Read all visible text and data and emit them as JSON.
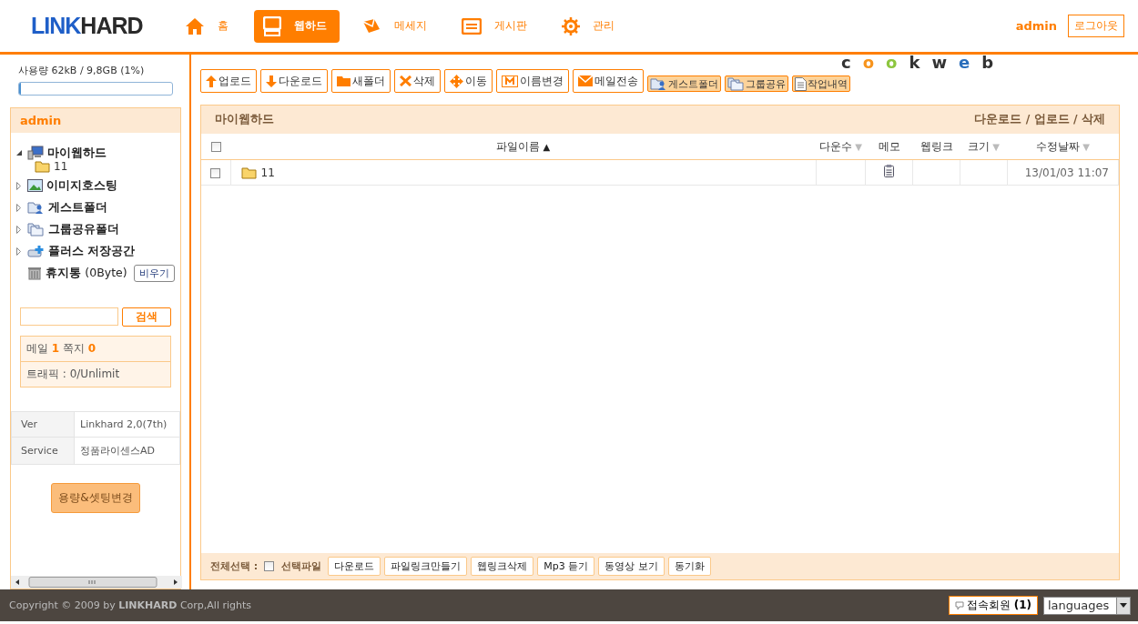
{
  "logo": [
    {
      "text": "LINK",
      "color": "#1f5fc8"
    },
    {
      "text": "HARD",
      "color": "#2a2a2a"
    }
  ],
  "nav": [
    {
      "label": "홈",
      "kind": "home",
      "selected": false
    },
    {
      "label": "웹하드",
      "kind": "monitor",
      "selected": true
    },
    {
      "label": "메세지",
      "kind": "message",
      "selected": false
    },
    {
      "label": "게시판",
      "kind": "board",
      "selected": false
    },
    {
      "label": "관리",
      "kind": "gear",
      "selected": false
    }
  ],
  "user": "admin",
  "logout": "로그아웃",
  "usage": {
    "text": "사용량 62kB / 9,8GB (1%)",
    "level": 0.01
  },
  "sidebar": {
    "title": "admin",
    "tree": [
      {
        "label": "마이웹하드",
        "kind": "computer",
        "expanded": true,
        "children": [
          {
            "label": "11",
            "kind": "folder"
          }
        ]
      },
      {
        "label": "이미지호스팅",
        "kind": "image",
        "expanded": false
      },
      {
        "label": "게스트폴더",
        "kind": "guest",
        "expanded": false
      },
      {
        "label": "그룹공유폴더",
        "kind": "group",
        "expanded": false
      },
      {
        "label": "플러스 저장공간",
        "kind": "plus",
        "expanded": false
      }
    ],
    "trash": {
      "label": "휴지통",
      "size": "(0Byte)",
      "button": "비우기"
    },
    "search_button": "검색",
    "mail": {
      "label": "메일",
      "count": "1",
      "note_label": "쪽지",
      "note_count": "0"
    },
    "traffic": "트래픽 : 0/Unlimit",
    "info": [
      {
        "key": "Ver",
        "value": "Linkhard 2,0(7th)"
      },
      {
        "key": "Service",
        "value": "정품라이센스AD"
      }
    ],
    "settings_button": "용량&셋팅변경"
  },
  "toolbar": [
    {
      "label": "업로드",
      "kind": "up",
      "highlighted": false
    },
    {
      "label": "다운로드",
      "kind": "down",
      "highlighted": false
    },
    {
      "label": "새폴더",
      "kind": "folder",
      "highlighted": false
    },
    {
      "label": "삭제",
      "kind": "x",
      "highlighted": false
    },
    {
      "label": "이동",
      "kind": "move",
      "highlighted": false
    },
    {
      "label": "이름변경",
      "kind": "m",
      "highlighted": false
    },
    {
      "label": "메일전송",
      "kind": "mail",
      "highlighted": false
    },
    {
      "label": "게스트폴더",
      "kind": "guest",
      "highlighted": true
    },
    {
      "label": "그룹공유",
      "kind": "group",
      "highlighted": true
    },
    {
      "label": "작업내역",
      "kind": "doc",
      "highlighted": true
    }
  ],
  "brand": [
    {
      "text": "c",
      "color": "#333333"
    },
    {
      "text": "o",
      "color": "#f7941d"
    },
    {
      "text": "o",
      "color": "#8dc63f"
    },
    {
      "text": "k",
      "color": "#333333"
    },
    {
      "text": "w",
      "color": "#333333"
    },
    {
      "text": "e",
      "color": "#2a6ebb"
    },
    {
      "text": "b",
      "color": "#333333"
    }
  ],
  "panel": {
    "title": "마이웹하드",
    "actions": "다운로드 / 업로드 / 삭제",
    "columns": [
      {
        "label": "파일이름",
        "sort": "▲",
        "active": true
      },
      {
        "label": "다운수",
        "sort": "▼",
        "active": false
      },
      {
        "label": "메모"
      },
      {
        "label": "웹링크"
      },
      {
        "label": "크기",
        "sort": "▼",
        "active": false
      },
      {
        "label": "수정날짜",
        "sort": "▼",
        "active": false
      }
    ],
    "select_all": {
      "checked": false
    },
    "rows": [
      {
        "name": "11",
        "kind": "folder",
        "checked": false,
        "memo": true,
        "date": "13/01/03 11:07"
      }
    ],
    "select_all_label": "전체선택 :",
    "bottom_checked": false,
    "selected_label": "선택파일",
    "actions_bottom": [
      "다운로드",
      "파일링크만들기",
      "웹링크삭제",
      "Mp3 듣기",
      "동영상 보기",
      "동기화"
    ]
  },
  "footer": {
    "copyright": "Copyright © 2009 by **LINKHARD** Corp,All rights",
    "users": "접속회원 **(1)**",
    "language": "languages"
  }
}
